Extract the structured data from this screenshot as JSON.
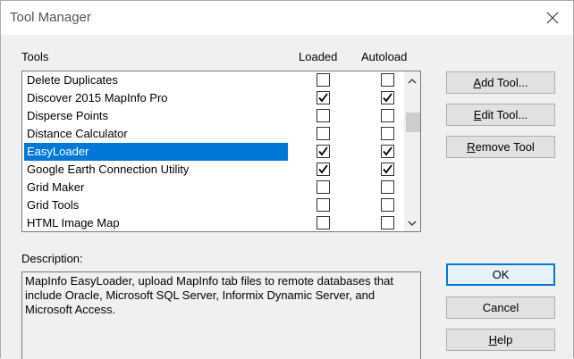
{
  "window": {
    "title": "Tool Manager"
  },
  "headers": {
    "tools": "Tools",
    "loaded": "Loaded",
    "autoload": "Autoload"
  },
  "tools": [
    {
      "name": "Delete Duplicates",
      "loaded": false,
      "autoload": false,
      "selected": false
    },
    {
      "name": "Discover 2015 MapInfo Pro",
      "loaded": true,
      "autoload": true,
      "selected": false
    },
    {
      "name": "Disperse Points",
      "loaded": false,
      "autoload": false,
      "selected": false
    },
    {
      "name": "Distance Calculator",
      "loaded": false,
      "autoload": false,
      "selected": false
    },
    {
      "name": "EasyLoader",
      "loaded": true,
      "autoload": true,
      "selected": true
    },
    {
      "name": "Google Earth Connection Utility",
      "loaded": true,
      "autoload": true,
      "selected": false
    },
    {
      "name": "Grid Maker",
      "loaded": false,
      "autoload": false,
      "selected": false
    },
    {
      "name": "Grid Tools",
      "loaded": false,
      "autoload": false,
      "selected": false
    },
    {
      "name": "HTML Image Map",
      "loaded": false,
      "autoload": false,
      "selected": false
    }
  ],
  "description": {
    "label": "Description:",
    "text": "MapInfo EasyLoader, upload MapInfo tab files to remote databases that include Oracle, Microsoft SQL Server, Informix Dynamic Server, and Microsoft Access."
  },
  "buttons": {
    "add_tool": {
      "mnemonic": "A",
      "rest": "dd Tool..."
    },
    "edit_tool": {
      "mnemonic": "E",
      "rest": "dit Tool..."
    },
    "remove_tool": {
      "mnemonic": "R",
      "rest": "emove Tool"
    },
    "ok": "OK",
    "cancel": "Cancel",
    "help": {
      "mnemonic": "H",
      "rest": "elp"
    }
  },
  "icons": {
    "close": "close-icon",
    "check": "check-icon",
    "scroll_up": "chevron-up-icon",
    "scroll_down": "chevron-down-icon"
  },
  "colors": {
    "selection": "#0078d7",
    "default_button_border": "#0078d7"
  }
}
